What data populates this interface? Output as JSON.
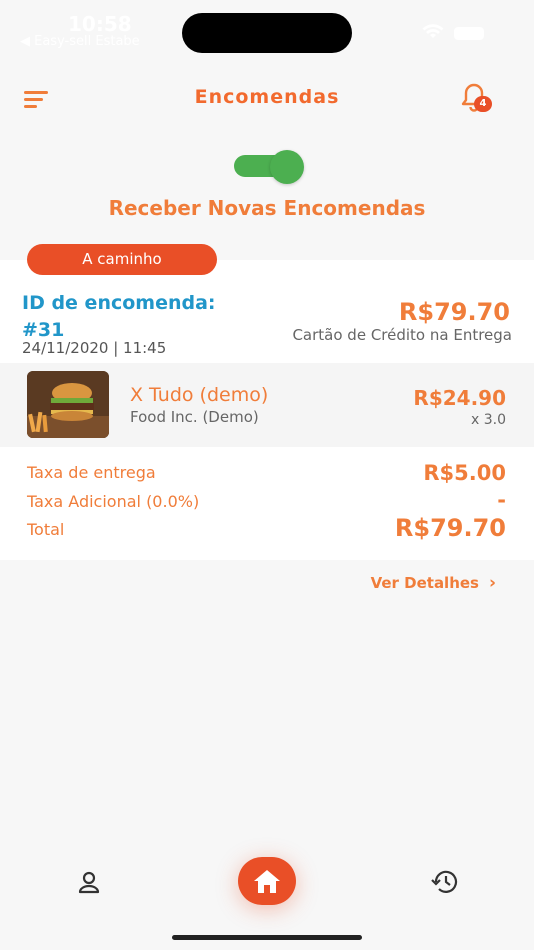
{
  "status_bar": {
    "time": "10:58",
    "back_app": "◀ Easy-sell Estabe"
  },
  "header": {
    "title": "Encomendas",
    "notification_count": "4"
  },
  "toggle": {
    "on": true,
    "label": "Receber Novas Encomendas"
  },
  "order": {
    "status": "A caminho",
    "id_label": "ID de encomenda:",
    "id_number": "#31",
    "date": "24/11/2020 | 11:45",
    "total": "R$79.70",
    "payment_method": "Cartão de Crédito na Entrega",
    "item": {
      "name": "X Tudo (demo)",
      "vendor": "Food Inc. (Demo)",
      "price": "R$24.90",
      "quantity": "x 3.0"
    },
    "fees": {
      "delivery_label": "Taxa de entrega",
      "delivery_value": "R$5.00",
      "additional_label": "Taxa Adicional (0.0%)",
      "additional_value": "-",
      "total_label": "Total",
      "total_value": "R$79.70"
    },
    "details_link": "Ver Detalhes"
  },
  "colors": {
    "accent": "#f07d3a",
    "status_red": "#e94f27",
    "id_blue": "#2196c9",
    "toggle_green": "#4caf50"
  },
  "icons": {
    "menu": "menu-icon",
    "notification": "bell-icon",
    "profile": "user-icon",
    "home": "home-icon",
    "history": "history-icon",
    "chevron": "chevron-right-icon"
  }
}
